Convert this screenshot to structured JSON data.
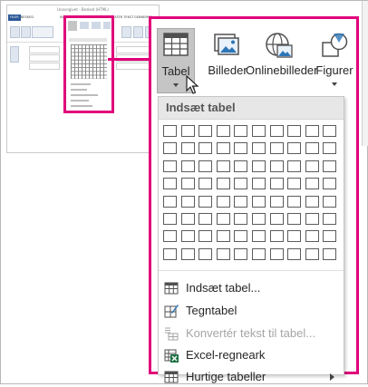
{
  "mini_window": {
    "title": "Unavngivet - Besked (HTML)",
    "tabs": [
      "FILER",
      "BESKED",
      "INDSÆT",
      "INDSTILLINGER",
      "FORMATER TEKST",
      "GENNEMSE"
    ],
    "active_tab": "INDSÆT"
  },
  "ribbon": {
    "buttons": [
      {
        "label": "Tabel",
        "icon": "table-icon",
        "has_dropdown": true
      },
      {
        "label": "Billeder",
        "icon": "picture-icon"
      },
      {
        "label": "Onlinebilleder",
        "icon": "online-picture-icon"
      },
      {
        "label": "Figurer",
        "icon": "shapes-icon",
        "has_dropdown": true
      }
    ]
  },
  "insert_table_menu": {
    "header": "Indsæt tabel",
    "grid": {
      "columns": 10,
      "rows": 8
    },
    "items": [
      {
        "label": "Indsæt tabel...",
        "icon": "insert-table-icon",
        "enabled": true
      },
      {
        "label": "Tegntabel",
        "icon": "draw-table-icon",
        "enabled": true
      },
      {
        "label": "Konvertér tekst til tabel...",
        "icon": "convert-text-icon",
        "enabled": false
      },
      {
        "label": "Excel-regneark",
        "icon": "excel-icon",
        "enabled": true
      },
      {
        "label": "Hurtige tabeller",
        "icon": "quick-tables-icon",
        "enabled": true,
        "submenu": true
      }
    ]
  },
  "colors": {
    "highlight": "#e0007a",
    "accent": "#2b5797",
    "excel_green": "#1e7145"
  }
}
